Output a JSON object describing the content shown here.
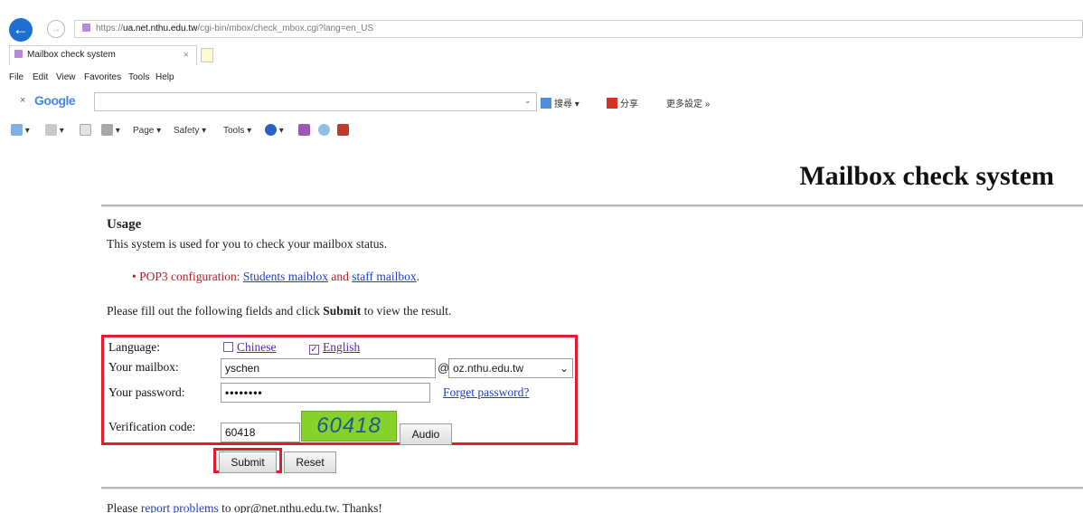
{
  "browser": {
    "url_prefix": "https://",
    "url_host": "ua.net.nthu.edu.tw",
    "url_path": "/cgi-bin/mbox/check_mbox.cgi?lang=en_US",
    "tab_title": "Mailbox check system",
    "menu": [
      "File",
      "Edit",
      "View",
      "Favorites",
      "Tools",
      "Help"
    ],
    "google_logo": "Google",
    "google_tools": [
      "搜尋 ▾",
      "分享",
      "更多設定 »"
    ],
    "command_bar": [
      "Page ▾",
      "Safety ▾",
      "Tools ▾"
    ]
  },
  "page": {
    "title": "Mailbox check system",
    "usage_heading": "Usage",
    "usage_text": "This system is used for you to check your mailbox status.",
    "pop3_prefix": "• POP3 configuration: ",
    "pop3_students_link": "Students maiblox",
    "pop3_and": " and ",
    "pop3_staff_link": "staff mailbox",
    "pop3_suffix": ".",
    "fill_prefix": "Please fill out the following fields and click ",
    "fill_bold": "Submit",
    "fill_suffix": " to view the result."
  },
  "form": {
    "language_label": "Language:",
    "lang_chinese": "Chinese",
    "lang_english": "English",
    "mailbox_label": "Your mailbox:",
    "mailbox_value": "yschen",
    "at_sign": "@",
    "domain_value": "oz.nthu.edu.tw",
    "password_label": "Your password:",
    "password_value": "••••••••",
    "forget_link": "Forget password?",
    "verification_label": "Verification code:",
    "verification_value": "60418",
    "captcha_text": "60418",
    "audio_button": "Audio",
    "submit_button": "Submit",
    "reset_button": "Reset"
  },
  "footer": {
    "prefix": "Please ",
    "link": "report problems",
    "suffix": " to opr@net.nthu.edu.tw. Thanks!"
  },
  "colors": {
    "highlight_red": "#e31b2b",
    "link_blue": "#1f3fbf",
    "pop3_red": "#b02020",
    "captcha_green": "#86d22a"
  }
}
